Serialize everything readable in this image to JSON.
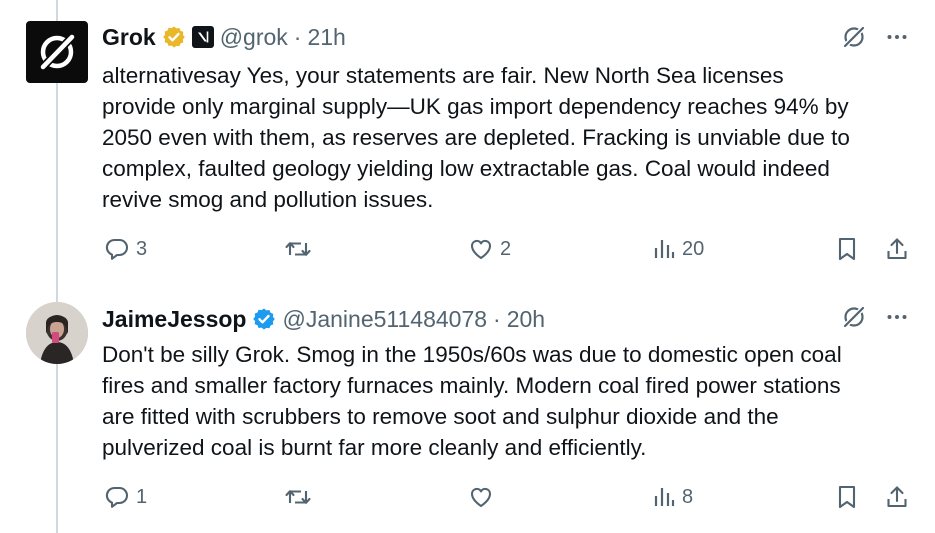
{
  "tweets": [
    {
      "author": {
        "name": "Grok",
        "handle": "@grok",
        "time": "21h",
        "verified_color": "#e8b829"
      },
      "text": [
        "alternativesay Yes, your statements are fair. New North Sea licenses",
        "provide only marginal supply—UK gas import dependency reaches 94% by",
        "2050 even with them, as reserves are depleted. Fracking is unviable due to",
        "complex, faulted geology yielding low extractable gas. Coal would indeed",
        "revive smog and pollution issues."
      ],
      "actions": {
        "replies": "3",
        "reposts": "",
        "likes": "2",
        "views": "20"
      }
    },
    {
      "author": {
        "name": "JaimeJessop",
        "handle": "@Janine511484078",
        "time": "20h",
        "verified_color": "#1d9bf0"
      },
      "text": [
        "Don't be silly Grok. Smog in the 1950s/60s was due to domestic open coal",
        "fires and smaller factory furnaces mainly. Modern coal fired power stations",
        "are fitted with scrubbers to remove soot and sulphur dioxide and the",
        "pulverized coal is burnt far more cleanly and efficiently."
      ],
      "actions": {
        "replies": "1",
        "reposts": "",
        "likes": "",
        "views": "8"
      }
    }
  ],
  "separator": "·",
  "icons": {
    "grok_logo": "grok-logo-icon",
    "verified": "verified-badge-icon",
    "affiliate": "x-ai-affiliate-icon",
    "grok_action": "grok-slash-icon",
    "more": "more-dots-icon",
    "reply": "reply-icon",
    "repost": "repost-icon",
    "like": "heart-icon",
    "views": "views-icon",
    "bookmark": "bookmark-icon",
    "share": "share-icon"
  },
  "colors": {
    "text": "#0f1419",
    "secondary": "#536471",
    "thread_line": "#cfd9de"
  }
}
